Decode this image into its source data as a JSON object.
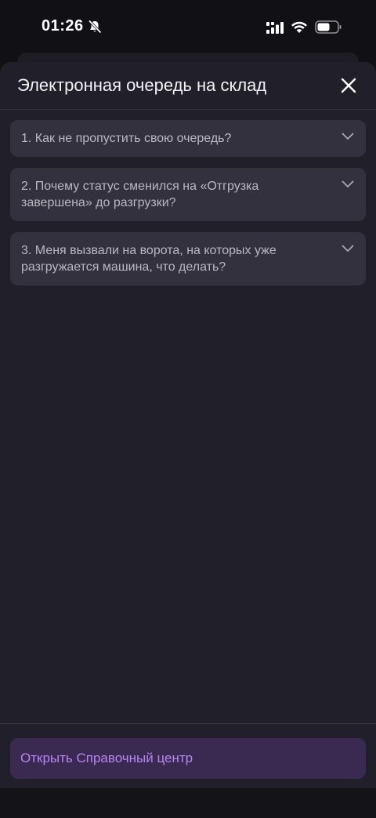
{
  "status_bar": {
    "time": "01:26",
    "icons": [
      "bell-slash-icon",
      "signal-icon",
      "wifi-icon",
      "battery-icon"
    ]
  },
  "sheet": {
    "title": "Электронная очередь на склад",
    "close_icon": "close-icon"
  },
  "faq": [
    {
      "text": "1. Как не пропустить свою очередь?"
    },
    {
      "text": "2. Почему статус сменился на «Отгрузка завершена» до разгрузки?"
    },
    {
      "text": "3. Меня вызвали на ворота, на которых уже разгружается машина, что делать?"
    }
  ],
  "footer": {
    "help_button_label": "Открыть Справочный центр"
  },
  "colors": {
    "sheet_bg": "#211f29",
    "card_bg": "#34313e",
    "accent": "#b884f2",
    "accent_bg": "#3a2a52"
  }
}
